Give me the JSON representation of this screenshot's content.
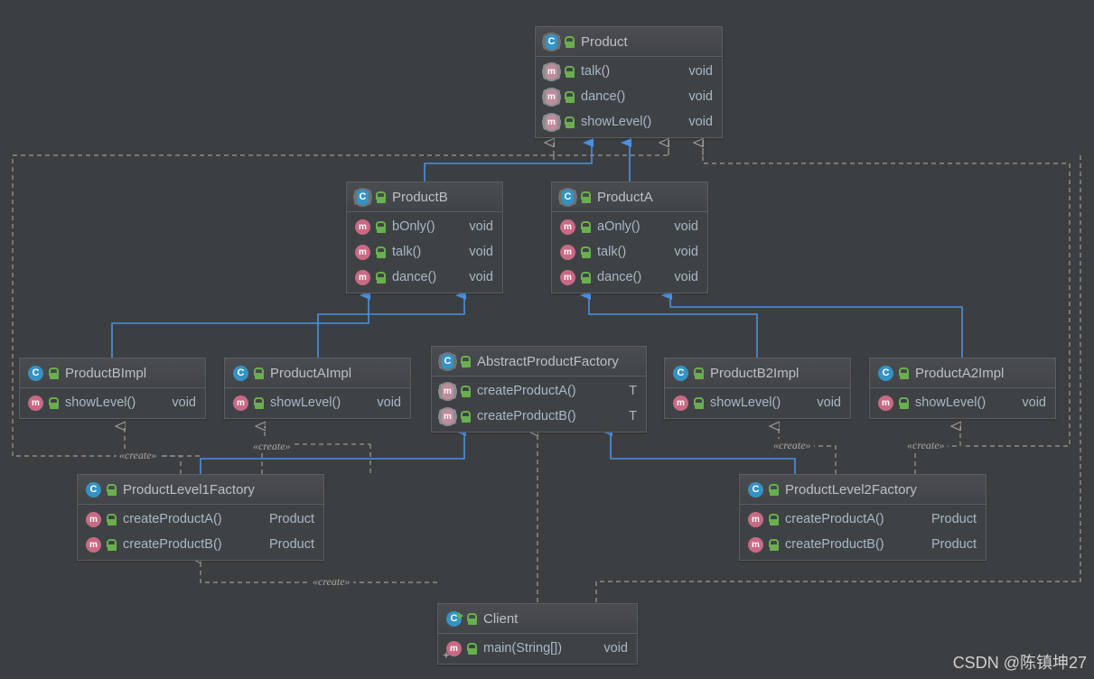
{
  "diagram": {
    "title": "Abstract Factory UML class diagram",
    "background_color": "#3c3f41",
    "box_fill": "#3f4245",
    "inheritance_color": "#4a90e2",
    "realization_color": "#9b9b9b",
    "icon_names": {
      "interface": "interface-icon",
      "class": "class-icon",
      "runnable_class": "runnable-class-icon",
      "method": "method-icon",
      "abstract_method": "abstract-method-icon",
      "public_lock": "public-visibility-icon"
    }
  },
  "classes": [
    {
      "id": "product",
      "name": "Product",
      "kind": "interface",
      "members": [
        {
          "name": "talk()",
          "type": "void",
          "kind": "abstract-method"
        },
        {
          "name": "dance()",
          "type": "void",
          "kind": "abstract-method"
        },
        {
          "name": "showLevel()",
          "type": "void",
          "kind": "abstract-method"
        }
      ]
    },
    {
      "id": "productB",
      "name": "ProductB",
      "kind": "interface",
      "members": [
        {
          "name": "bOnly()",
          "type": "void",
          "kind": "abstract-method"
        },
        {
          "name": "talk()",
          "type": "void",
          "kind": "abstract-method"
        },
        {
          "name": "dance()",
          "type": "void",
          "kind": "abstract-method"
        }
      ]
    },
    {
      "id": "productA",
      "name": "ProductA",
      "kind": "interface",
      "members": [
        {
          "name": "aOnly()",
          "type": "void",
          "kind": "abstract-method"
        },
        {
          "name": "talk()",
          "type": "void",
          "kind": "abstract-method"
        },
        {
          "name": "dance()",
          "type": "void",
          "kind": "abstract-method"
        }
      ]
    },
    {
      "id": "productBImpl",
      "name": "ProductBImpl",
      "kind": "class",
      "members": [
        {
          "name": "showLevel()",
          "type": "void",
          "kind": "method"
        }
      ]
    },
    {
      "id": "productAImpl",
      "name": "ProductAImpl",
      "kind": "class",
      "members": [
        {
          "name": "showLevel()",
          "type": "void",
          "kind": "method"
        }
      ]
    },
    {
      "id": "abstractProductFactory",
      "name": "AbstractProductFactory",
      "kind": "interface",
      "members": [
        {
          "name": "createProductA()",
          "type": "T",
          "kind": "abstract-method"
        },
        {
          "name": "createProductB()",
          "type": "T",
          "kind": "abstract-method"
        }
      ]
    },
    {
      "id": "productB2Impl",
      "name": "ProductB2Impl",
      "kind": "class",
      "members": [
        {
          "name": "showLevel()",
          "type": "void",
          "kind": "method"
        }
      ]
    },
    {
      "id": "productA2Impl",
      "name": "ProductA2Impl",
      "kind": "class",
      "members": [
        {
          "name": "showLevel()",
          "type": "void",
          "kind": "method"
        }
      ]
    },
    {
      "id": "productLevel1Factory",
      "name": "ProductLevel1Factory",
      "kind": "class",
      "members": [
        {
          "name": "createProductA()",
          "type": "Product",
          "kind": "method"
        },
        {
          "name": "createProductB()",
          "type": "Product",
          "kind": "method"
        }
      ]
    },
    {
      "id": "productLevel2Factory",
      "name": "ProductLevel2Factory",
      "kind": "class",
      "members": [
        {
          "name": "createProductA()",
          "type": "Product",
          "kind": "method"
        },
        {
          "name": "createProductB()",
          "type": "Product",
          "kind": "method"
        }
      ]
    },
    {
      "id": "client",
      "name": "Client",
      "kind": "runnable-class",
      "members": [
        {
          "name": "main(String[])",
          "type": "void",
          "kind": "static-method"
        }
      ]
    }
  ],
  "edge_labels": [
    {
      "id": "create-1",
      "text": "«create»"
    },
    {
      "id": "create-2",
      "text": "«create»"
    },
    {
      "id": "create-3",
      "text": "«create»"
    },
    {
      "id": "create-4",
      "text": "«create»"
    },
    {
      "id": "create-5",
      "text": "«create»"
    }
  ],
  "watermark": {
    "text": "CSDN @陈镇坤27"
  }
}
